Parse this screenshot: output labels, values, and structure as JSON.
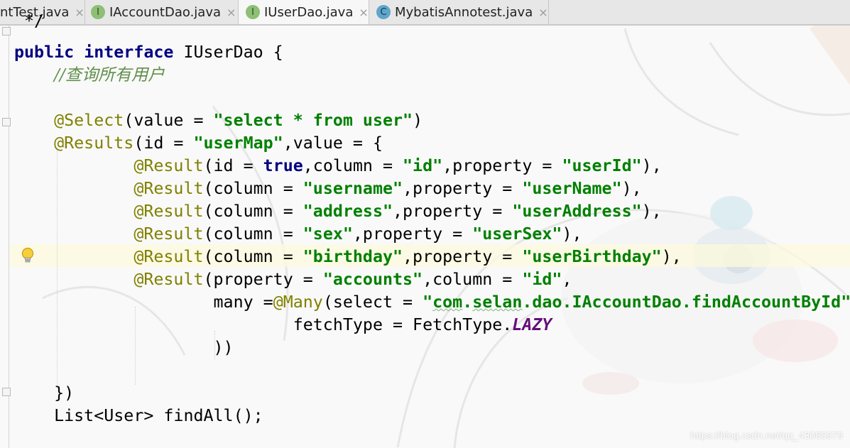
{
  "tabs": [
    {
      "label": "ntTest.java",
      "icon": "none",
      "active": false
    },
    {
      "label": "IAccountDao.java",
      "icon_letter": "I",
      "active": false
    },
    {
      "label": "IUserDao.java",
      "icon_letter": "I",
      "active": true
    },
    {
      "label": "MybatisAnnotest.java",
      "icon_letter": "C",
      "active": false
    }
  ],
  "tab_close_glyph": "×",
  "code": {
    "l0": "*/",
    "l1_kw1": "public",
    "l1_kw2": "interface",
    "l1_rest": " IUserDao {",
    "l2_comment": "//查询所有用户",
    "l4_ann": "@Select",
    "l4_a": "(value = ",
    "l4_s": "\"select * from user\"",
    "l4_b": ")",
    "l5_ann": "@Results",
    "l5_a": "(id = ",
    "l5_s": "\"userMap\"",
    "l5_b": ",value = {",
    "l6_ann": "@Result",
    "l6_a": "(id = ",
    "l6_kw": "true",
    "l6_b": ",column = ",
    "l6_s1": "\"id\"",
    "l6_c": ",property = ",
    "l6_s2": "\"userId\"",
    "l6_d": "),",
    "l7_ann": "@Result",
    "l7_a": "(column = ",
    "l7_s1": "\"username\"",
    "l7_b": ",property = ",
    "l7_s2": "\"userName\"",
    "l7_c": "),",
    "l8_ann": "@Result",
    "l8_a": "(column = ",
    "l8_s1": "\"address\"",
    "l8_b": ",property = ",
    "l8_s2": "\"userAddress\"",
    "l8_c": "),",
    "l9_ann": "@Result",
    "l9_a": "(column = ",
    "l9_s1": "\"sex\"",
    "l9_b": ",property = ",
    "l9_s2": "\"userSex\"",
    "l9_c": "),",
    "l10_ann": "@Result",
    "l10_a": "(column = ",
    "l10_s1": "\"birthday\"",
    "l10_b": ",property = ",
    "l10_s2": "\"userBirthday\"",
    "l10_c": "),",
    "l11_ann": "@Result",
    "l11_a": "(property = ",
    "l11_s1": "\"accounts\"",
    "l11_b": ",column = ",
    "l11_s2": "\"id\"",
    "l11_c": ",",
    "l12_a": "many =",
    "l12_ann": "@Many",
    "l12_b": "(select = ",
    "l12_s_q1": "\"",
    "l12_s_com": "com",
    "l12_s_dot": ".",
    "l12_s_selan": "selan",
    "l12_s_rest": ".dao.IAccountDao.findAccountById\"",
    "l13_a": "fetchType = FetchType.",
    "l13_const": "LAZY",
    "l14": "))",
    "l16": "})",
    "l17": "List<User> findAll();"
  },
  "watermark": "https://blog.csdn.net/qq_43085979",
  "colors": {
    "keyword": "#000080",
    "annotation": "#808000",
    "string": "#008000",
    "comment": "#628f4c",
    "constant": "#660e7a"
  }
}
